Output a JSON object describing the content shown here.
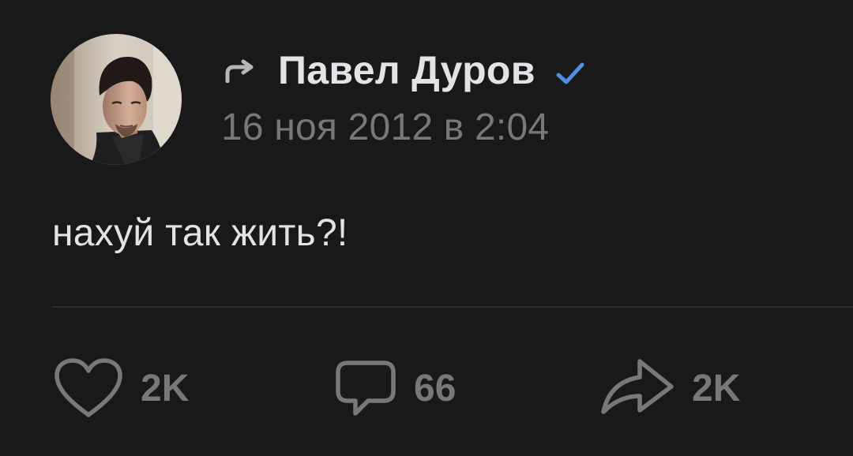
{
  "post": {
    "author": {
      "name": "Павел Дуров",
      "verified": true,
      "verified_color": "#4d8ee8"
    },
    "reposted": true,
    "date": "16 ноя 2012 в 2:04",
    "text": "нахуй так жить?!"
  },
  "actions": {
    "likes": "2K",
    "comments": "66",
    "shares": "2K"
  },
  "icons": {
    "repost": "repost-arrow-icon",
    "verified": "checkmark-icon",
    "like": "heart-outline-icon",
    "comment": "speech-bubble-icon",
    "share": "share-arrow-icon"
  },
  "colors": {
    "background": "#19191a",
    "text_primary": "#e1e3e6",
    "text_secondary": "#76787a",
    "divider": "#2c2d2e",
    "accent": "#4d8ee8"
  }
}
